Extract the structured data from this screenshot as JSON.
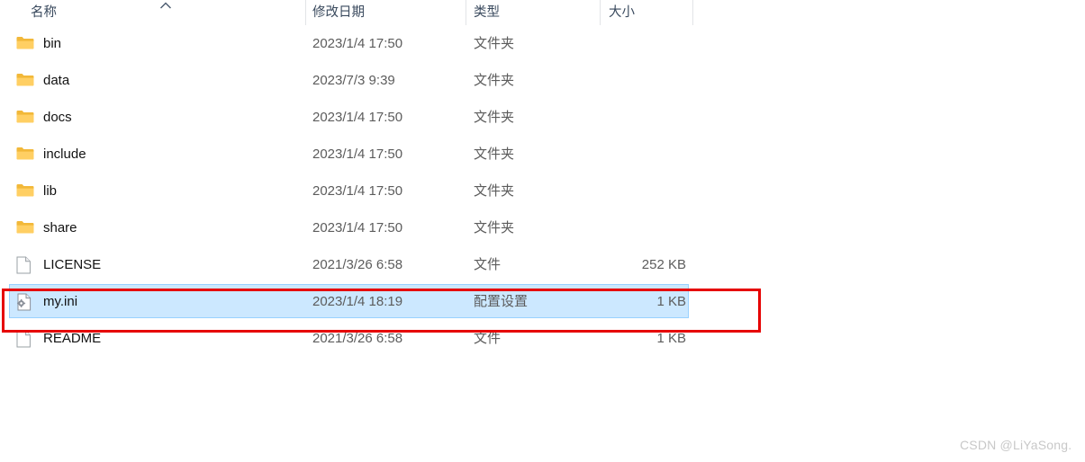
{
  "header": {
    "columns": [
      {
        "key": "name",
        "label": "名称"
      },
      {
        "key": "date",
        "label": "修改日期"
      },
      {
        "key": "type",
        "label": "类型"
      },
      {
        "key": "size",
        "label": "大小"
      }
    ],
    "sort": {
      "column": "名称",
      "direction": "ascending",
      "icon": "chevron-up-icon"
    }
  },
  "colors": {
    "selection_fill": "#cce8ff",
    "selection_border": "#99d1ff",
    "annotation_red": "#e60000",
    "folder_icon": "#f7c352",
    "folder_icon_dark": "#e8a824",
    "header_text": "#3a4a5e",
    "row_text": "#121212",
    "meta_text": "#5c5c5c",
    "watermark": "#c8c8c8"
  },
  "rows": [
    {
      "name": "bin",
      "date": "2023/1/4 17:50",
      "type": "文件夹",
      "size": "",
      "icon": "folder-icon",
      "selected": false
    },
    {
      "name": "data",
      "date": "2023/7/3 9:39",
      "type": "文件夹",
      "size": "",
      "icon": "folder-icon",
      "selected": false
    },
    {
      "name": "docs",
      "date": "2023/1/4 17:50",
      "type": "文件夹",
      "size": "",
      "icon": "folder-icon",
      "selected": false
    },
    {
      "name": "include",
      "date": "2023/1/4 17:50",
      "type": "文件夹",
      "size": "",
      "icon": "folder-icon",
      "selected": false
    },
    {
      "name": "lib",
      "date": "2023/1/4 17:50",
      "type": "文件夹",
      "size": "",
      "icon": "folder-icon",
      "selected": false
    },
    {
      "name": "share",
      "date": "2023/1/4 17:50",
      "type": "文件夹",
      "size": "",
      "icon": "folder-icon",
      "selected": false
    },
    {
      "name": "LICENSE",
      "date": "2021/3/26 6:58",
      "type": "文件",
      "size": "252 KB",
      "icon": "document-icon",
      "selected": false
    },
    {
      "name": "my.ini",
      "date": "2023/1/4 18:19",
      "type": "配置设置",
      "size": "1 KB",
      "icon": "config-file-icon",
      "selected": true
    },
    {
      "name": "README",
      "date": "2021/3/26 6:58",
      "type": "文件",
      "size": "1 KB",
      "icon": "document-icon",
      "selected": false
    }
  ],
  "annotation": {
    "shape": "rectangle",
    "color": "#e60000",
    "target_row": "my.ini"
  },
  "watermark": {
    "text": "CSDN @LiYaSong."
  }
}
